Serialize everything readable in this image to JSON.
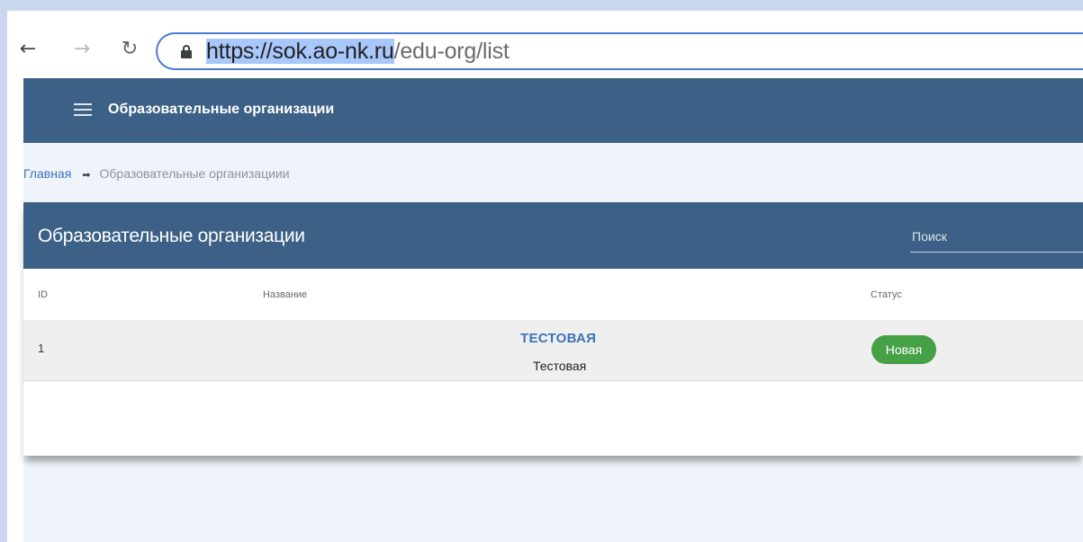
{
  "browser": {
    "url_highlighted": "https://sok.ao-nk.ru",
    "url_path": "/edu-org/list",
    "icons": {
      "back": "arrow-left",
      "forward": "arrow-right",
      "reload": "reload",
      "lock": "lock"
    },
    "address_border_color": "#4a7bd6"
  },
  "app": {
    "topbar": {
      "title": "Образовательные организации",
      "color": "#3d6186",
      "icon": "menu"
    },
    "breadcrumb": {
      "home": "Главная",
      "current": "Образовательные организациии"
    },
    "card": {
      "title": "Образовательные организации",
      "search_placeholder": "Поиск",
      "columns": {
        "id": "ID",
        "name": "Название",
        "status": "Статус"
      },
      "rows": [
        {
          "id": "1",
          "name_link": "ТЕСТОВАЯ",
          "name_sub": "Тестовая",
          "status": "Новая",
          "status_color": "#46a046"
        }
      ]
    }
  }
}
